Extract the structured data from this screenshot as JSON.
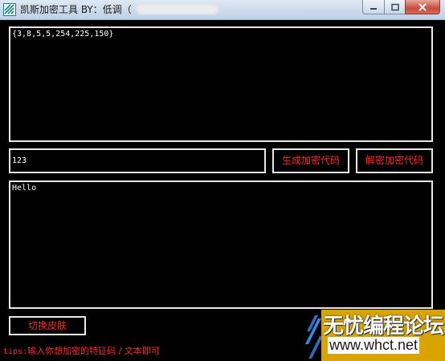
{
  "window": {
    "title": "凯斯加密工具  BY：低调（",
    "controls": {
      "minimize_icon": "minimize-icon",
      "maximize_icon": "maximize-icon",
      "close_icon": "close-icon"
    }
  },
  "output": {
    "text": "{3,8,5,5,254,225,150}"
  },
  "key_input": {
    "value": "123"
  },
  "buttons": {
    "generate": "生成加密代码",
    "decrypt": "解密加密代码",
    "switch_skin": "切换皮肤"
  },
  "plaintext": {
    "value": "Hello"
  },
  "tips": {
    "prefix": "tips:",
    "text": "输入你想加密的特征码 / 文本即可"
  },
  "watermark": {
    "line1": "无忧编程论坛",
    "line2": "www.whct.net"
  },
  "colors": {
    "background": "#000000",
    "border": "#e8e8e8",
    "accent_text": "#ff2a2a",
    "watermark_gold": "#d9a400"
  }
}
